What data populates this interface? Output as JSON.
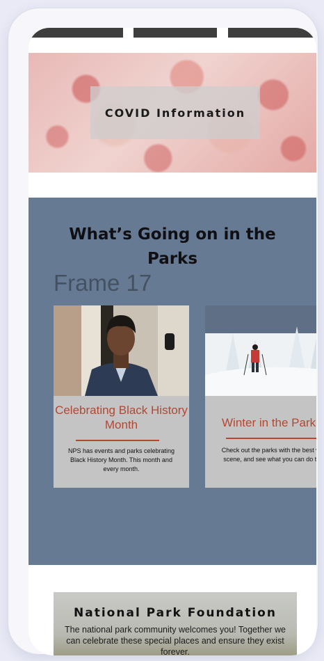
{
  "hero": {
    "label": "COVID Information"
  },
  "parks": {
    "title": "What’s Going on in the Parks",
    "frame_label": "Frame 17",
    "cards": [
      {
        "title": "Celebrating Black History Month",
        "text": "NPS has events and parks celebrating Black History Month. This month and every month."
      },
      {
        "title": "Winter in the Park",
        "text": "Check out the parks with the best winter scene, and see what you can do there!"
      }
    ]
  },
  "foundation": {
    "title": "National Park Foundation",
    "text": "The national park community welcomes you! Together we can celebrate these special places and ensure they exist forever."
  },
  "colors": {
    "accent": "#b34733",
    "section_bg": "#667b93",
    "card_bg": "#c4c4c4"
  }
}
